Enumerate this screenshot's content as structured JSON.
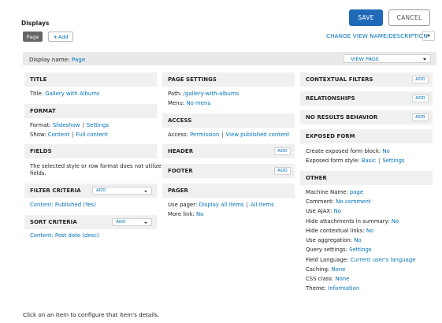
{
  "header": {
    "save_label": "SAVE",
    "cancel_label": "CANCEL",
    "displays_title": "Displays",
    "tab_page": "Page",
    "tab_add": "Add",
    "change_view": "CHANGE VIEW NAME/DESCRIPTION"
  },
  "display_name": {
    "label": "Display name:",
    "value": "Page",
    "view_page": "VIEW PAGE"
  },
  "col1": {
    "title": {
      "head": "TITLE",
      "label": "Title:",
      "value": "Gallery with Albums"
    },
    "format": {
      "head": "FORMAT",
      "format_label": "Format:",
      "format_value": "Slideshow",
      "format_settings": "Settings",
      "show_label": "Show:",
      "show_value": "Content",
      "show_settings": "Full content"
    },
    "fields": {
      "head": "FIELDS",
      "text1": "The selected style or row format does not utilize",
      "text2": "fields."
    },
    "filter": {
      "head": "FILTER CRITERIA",
      "add": "ADD",
      "item": "Content: Published (Yes)"
    },
    "sort": {
      "head": "SORT CRITERIA",
      "add": "ADD",
      "item": "Content: Post date (desc)"
    }
  },
  "col2": {
    "page_settings": {
      "head": "PAGE SETTINGS",
      "path_label": "Path:",
      "path_value": "/gallery-with-albums",
      "menu_label": "Menu:",
      "menu_value": "No menu"
    },
    "access": {
      "head": "ACCESS",
      "label": "Access:",
      "value": "Permission",
      "settings": "View published content"
    },
    "header": {
      "head": "HEADER",
      "add": "ADD"
    },
    "footer": {
      "head": "FOOTER",
      "add": "ADD"
    },
    "pager": {
      "head": "PAGER",
      "use_label": "Use pager:",
      "use_value": "Display all items",
      "use_settings": "All items",
      "more_label": "More link:",
      "more_value": "No"
    }
  },
  "col3": {
    "contextual": {
      "head": "CONTEXTUAL FILTERS",
      "add": "ADD"
    },
    "relationships": {
      "head": "RELATIONSHIPS",
      "add": "ADD"
    },
    "no_results": {
      "head": "NO RESULTS BEHAVIOR",
      "add": "ADD"
    },
    "exposed": {
      "head": "EXPOSED FORM",
      "block_label": "Create exposed form block:",
      "block_value": "No",
      "style_label": "Exposed form style:",
      "style_value": "Basic",
      "style_settings": "Settings"
    },
    "other": {
      "head": "OTHER",
      "rows": [
        {
          "label": "Machine Name:",
          "value": "page"
        },
        {
          "label": "Comment:",
          "value": "No comment"
        },
        {
          "label": "Use AJAX:",
          "value": "No"
        },
        {
          "label": "Hide attachments in summary:",
          "value": "No"
        },
        {
          "label": "Hide contextual links:",
          "value": "No"
        },
        {
          "label": "Use aggregation:",
          "value": "No"
        },
        {
          "label": "Query settings:",
          "value": "Settings"
        },
        {
          "label": "Field Language:",
          "value": "Current user's language"
        },
        {
          "label": "Caching:",
          "value": "None"
        },
        {
          "label": "CSS class:",
          "value": "None"
        },
        {
          "label": "Theme:",
          "value": "Information"
        }
      ]
    }
  },
  "footer_note": "Click on an item to configure that item's details."
}
